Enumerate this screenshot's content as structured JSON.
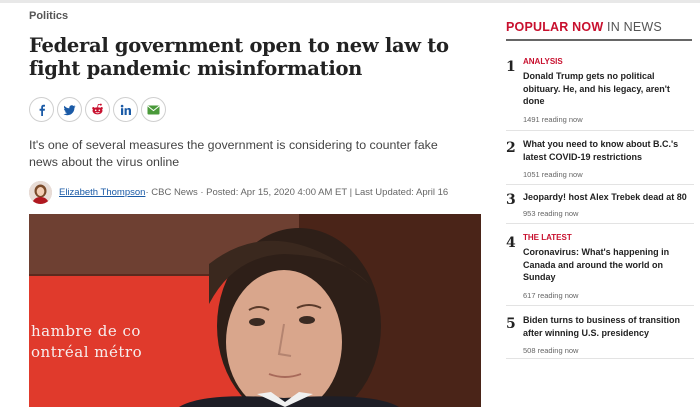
{
  "article": {
    "category": "Politics",
    "headline": "Federal government open to new law to fight pandemic misinformation",
    "share_icons": [
      "facebook-icon",
      "twitter-icon",
      "reddit-icon",
      "linkedin-icon",
      "email-icon"
    ],
    "dek": "It's one of several measures the government is considering to counter fake news about the virus online",
    "byline": {
      "author": "Elizabeth Thompson",
      "meta": " · CBC News · Posted: Apr 15, 2020 4:00 AM ET | Last Updated: April 16"
    },
    "hero_image": {
      "text_line1": "hambre de co",
      "text_line2": "ontréal métro"
    }
  },
  "sidebar": {
    "title_main": "POPULAR NOW",
    "title_sub": " IN NEWS",
    "items": [
      {
        "number": "1",
        "label": "ANALYSIS",
        "headline": "Donald Trump gets no political obituary. He, and his legacy, aren't done",
        "count": "1491 reading now"
      },
      {
        "number": "2",
        "label": "",
        "headline": "What you need to know about B.C.'s latest COVID-19 restrictions",
        "count": "1051 reading now"
      },
      {
        "number": "3",
        "label": "",
        "headline": "Jeopardy! host Alex Trebek dead at 80",
        "count": "953 reading now"
      },
      {
        "number": "4",
        "label": "THE LATEST",
        "headline": "Coronavirus: What's happening in Canada and around the world on Sunday",
        "count": "617 reading now"
      },
      {
        "number": "5",
        "label": "",
        "headline": "Biden turns to business of transition after winning U.S. presidency",
        "count": "508 reading now"
      }
    ]
  },
  "colors": {
    "accent": "#c8102e",
    "link": "#1a5aa6"
  }
}
